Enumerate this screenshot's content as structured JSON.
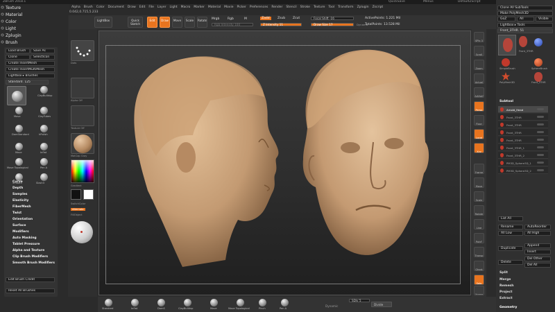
{
  "window": {
    "titlebar_left": "ZBrush 2018.1",
    "titlebar_right": [
      "QuickSave",
      "Menus",
      "DefaultZScript"
    ],
    "coords": "0.042,0.715,5.233"
  },
  "menubar": [
    "Alpha",
    "Brush",
    "Color",
    "Document",
    "Draw",
    "Edit",
    "File",
    "Layer",
    "Light",
    "Macro",
    "Marker",
    "Material",
    "Movie",
    "Picker",
    "Preferences",
    "Render",
    "Stencil",
    "Stroke",
    "Texture",
    "Tool",
    "Transform",
    "Zplugin",
    "Zscript"
  ],
  "left_menu": [
    "Texture",
    "Material",
    "Color",
    "Light",
    "Zplugin",
    "Brush"
  ],
  "brush_panel": {
    "buttons": [
      "Load Brush",
      "Save As",
      "Clone",
      "SelectIcon",
      "Create InsertMesh",
      "Create InsertMultiMesh",
      "Lightbox ▸ Brushes"
    ],
    "current": "Standard. 125",
    "brushes": [
      "Standard",
      "ClayBuildup",
      "Move",
      "Move Topological",
      "Smooth",
      "hPolish",
      "Inflat",
      "Dam Standard",
      "Pinch",
      "Pen A",
      "Slash3",
      "DamStandard",
      "Move",
      "ClayTubes"
    ],
    "subpalettes": [
      "Curve",
      "Depth",
      "Samples",
      "Elasticity",
      "FiberMesh",
      "Twist",
      "Orientation",
      "Surface",
      "Modifiers",
      "Auto Masking",
      "Tablet Pressure",
      "Alpha and Texture",
      "Clip Brush Modifiers",
      "Smooth Brush Modifiers"
    ],
    "footer": [
      "Edit Brush Credit",
      "Reset All Brushes"
    ]
  },
  "col2": {
    "labels": [
      "Projection Master",
      "LightBox",
      "Standard",
      "Dots",
      "Alpha Off",
      "Texture Off",
      "MatCap Gray",
      "Gradient",
      "SwitchColor",
      "Alternate",
      "FillObject"
    ]
  },
  "toolbar": {
    "buttons": [
      "Quick Sketch",
      "Edit",
      "Draw",
      "Move",
      "Scale",
      "Rotate"
    ],
    "mrgb": "Mrgb",
    "rgb": "Rgb",
    "m": "M",
    "zadd": "Zadd",
    "zsub": "Zsub",
    "zcut": "Zcut",
    "rgb_intensity": "Rgb Intensity 100",
    "z_intensity": "Z Intensity 11",
    "focal_shift": "Focal Shift -16",
    "draw_size": "Draw Size 17",
    "dynamic": "Dynamic",
    "active_points": "ActivePoints: 1.221 Mil",
    "total_points": "TotalPoints: 13.528 Mil"
  },
  "right_strip": [
    "SPix 3",
    "Scroll",
    "Zoom",
    "Actual",
    "AAHalf",
    "Persp",
    "Floor",
    "Local",
    "Xyz",
    "Frame",
    "Move",
    "Scale",
    "Rotate",
    "Line Fill",
    "PolyF",
    "Transp",
    "Ghost",
    "Solo",
    "Xpose"
  ],
  "right_panel": {
    "top": [
      "Clone All SubTools",
      "Make PolyMesh3D"
    ],
    "goz": "GoZ",
    "all": "All",
    "visible": "Visible",
    "lightbox_tools": "Lightbox ▸ Tools",
    "current_tool": "Front_3THR. 51",
    "tools": [
      "Front_3THR",
      "SimpleBrush",
      "SphereBrush",
      "PolyMesh3D",
      "Front_3THR"
    ],
    "subtool_title": "Subtool",
    "subtools": [
      "Arnold_Head",
      "Front_3THR",
      "Front_3THR",
      "Front_3THR",
      "Front_3THR",
      "Front_3THR_1",
      "Front_3THR_2",
      "PM3D_Sphere3D_1",
      "PM3D_Sphere3D_2"
    ],
    "list_all": "List All",
    "auto_reorder": "AutoReorder",
    "rename": "Rename",
    "all_low": "All Low",
    "all_high": "All High",
    "duplicate": "Duplicate",
    "append": "Append",
    "insert": "Insert",
    "delete": "Delete",
    "del_other": "Del Other",
    "del_all": "Del All",
    "sections": [
      "Split",
      "Merge",
      "Remesh",
      "Project",
      "Extract"
    ],
    "geometry": "Geometry"
  },
  "shelf": {
    "brushes": [
      "Standard",
      "Inflat",
      "DamS",
      "ClayBuildup",
      "Move",
      "Move Topological",
      "Pinch",
      "Pen A"
    ],
    "symmetry": "Dynamic",
    "sdiv": "SDiv 5",
    "divide": "Divide"
  },
  "colors": {
    "accent": "#e8741f",
    "head": "#c9a27c"
  }
}
